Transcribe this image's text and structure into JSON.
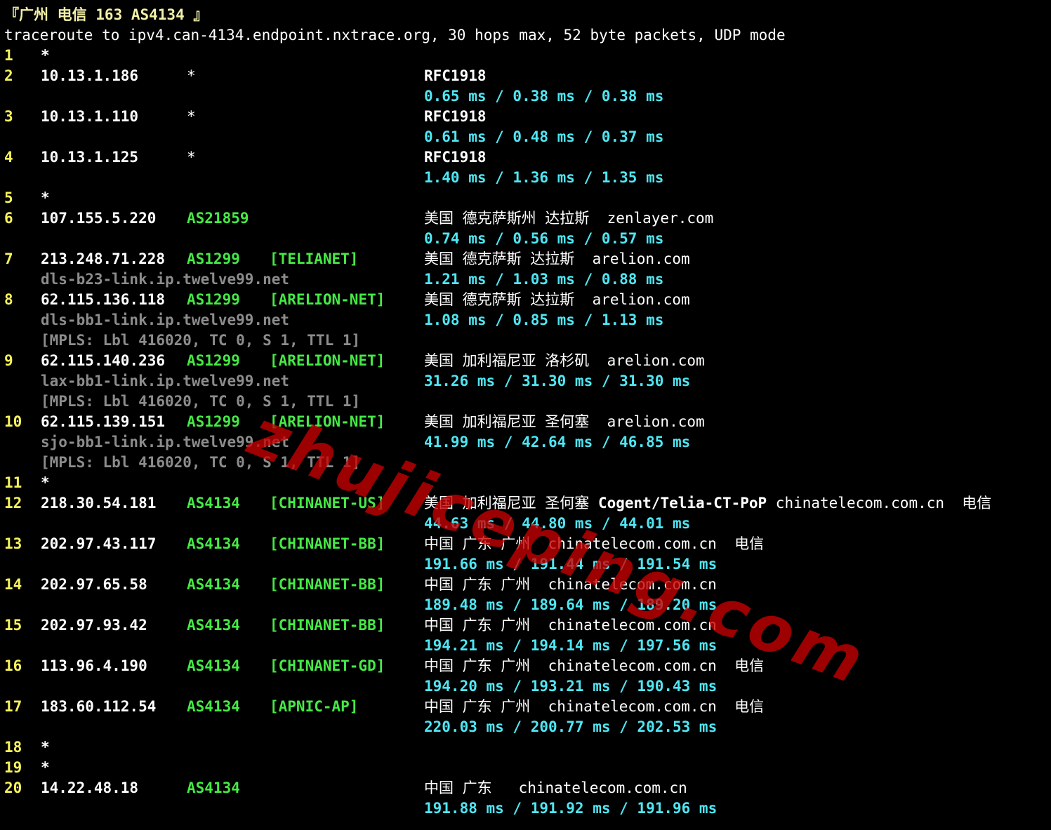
{
  "title": "『广州 电信 163 AS4134 』",
  "command": "traceroute to ipv4.can-4134.endpoint.nxtrace.org, 30 hops max, 52 byte packets, UDP mode",
  "hops": [
    {
      "n": "1",
      "ip": "*",
      "star2": "",
      "asn": "",
      "tag": "",
      "geo": "",
      "geob": "",
      "org": "",
      "rtt": "",
      "host": "",
      "mpls": ""
    },
    {
      "n": "2",
      "ip": "10.13.1.186",
      "star2": "*",
      "asn": "",
      "tag": "",
      "geo": "",
      "geob": "RFC1918",
      "org": "",
      "rtt": "0.65 ms / 0.38 ms / 0.38 ms",
      "host": "",
      "mpls": ""
    },
    {
      "n": "3",
      "ip": "10.13.1.110",
      "star2": "*",
      "asn": "",
      "tag": "",
      "geo": "",
      "geob": "RFC1918",
      "org": "",
      "rtt": "0.61 ms / 0.48 ms / 0.37 ms",
      "host": "",
      "mpls": ""
    },
    {
      "n": "4",
      "ip": "10.13.1.125",
      "star2": "*",
      "asn": "",
      "tag": "",
      "geo": "",
      "geob": "RFC1918",
      "org": "",
      "rtt": "1.40 ms / 1.36 ms / 1.35 ms",
      "host": "",
      "mpls": ""
    },
    {
      "n": "5",
      "ip": "*",
      "star2": "",
      "asn": "",
      "tag": "",
      "geo": "",
      "geob": "",
      "org": "",
      "rtt": "",
      "host": "",
      "mpls": ""
    },
    {
      "n": "6",
      "ip": "107.155.5.220",
      "star2": "",
      "asn": "AS21859",
      "tag": "",
      "geo": "美国 德克萨斯州 达拉斯  zenlayer.com",
      "geob": "",
      "org": "",
      "rtt": "0.74 ms / 0.56 ms / 0.57 ms",
      "host": "",
      "mpls": ""
    },
    {
      "n": "7",
      "ip": "213.248.71.228",
      "star2": "",
      "asn": "AS1299",
      "tag": "[TELIANET]",
      "geo": "美国 德克萨斯 达拉斯  arelion.com",
      "geob": "",
      "org": "",
      "rtt": "1.21 ms / 1.03 ms / 0.88 ms",
      "host": "dls-b23-link.ip.twelve99.net",
      "mpls": ""
    },
    {
      "n": "8",
      "ip": "62.115.136.118",
      "star2": "",
      "asn": "AS1299",
      "tag": "[ARELION-NET]",
      "geo": "美国 德克萨斯 达拉斯  arelion.com",
      "geob": "",
      "org": "",
      "rtt": "1.08 ms / 0.85 ms / 1.13 ms",
      "host": "dls-bb1-link.ip.twelve99.net",
      "mpls": "[MPLS: Lbl 416020, TC 0, S 1, TTL 1]"
    },
    {
      "n": "9",
      "ip": "62.115.140.236",
      "star2": "",
      "asn": "AS1299",
      "tag": "[ARELION-NET]",
      "geo": "美国 加利福尼亚 洛杉矶  arelion.com",
      "geob": "",
      "org": "",
      "rtt": "31.26 ms / 31.30 ms / 31.30 ms",
      "host": "lax-bb1-link.ip.twelve99.net",
      "mpls": "[MPLS: Lbl 416020, TC 0, S 1, TTL 1]"
    },
    {
      "n": "10",
      "ip": "62.115.139.151",
      "star2": "",
      "asn": "AS1299",
      "tag": "[ARELION-NET]",
      "geo": "美国 加利福尼亚 圣何塞  arelion.com",
      "geob": "",
      "org": "",
      "rtt": "41.99 ms / 42.64 ms / 46.85 ms",
      "host": "sjo-bb1-link.ip.twelve99.net",
      "mpls": "[MPLS: Lbl 416020, TC 0, S 1, TTL 1]"
    },
    {
      "n": "11",
      "ip": "*",
      "star2": "",
      "asn": "",
      "tag": "",
      "geo": "",
      "geob": "",
      "org": "",
      "rtt": "",
      "host": "",
      "mpls": ""
    },
    {
      "n": "12",
      "ip": "218.30.54.181",
      "star2": "",
      "asn": "AS4134",
      "tag": "[CHINANET-US]",
      "geo": "美国 加利福尼亚 圣何塞 ",
      "geob": "",
      "org": "Cogent/Telia-CT-PoP",
      "tail": " chinatelecom.com.cn  电信",
      "rtt": "44.63 ms / 44.80 ms / 44.01 ms",
      "host": "",
      "mpls": ""
    },
    {
      "n": "13",
      "ip": "202.97.43.117",
      "star2": "",
      "asn": "AS4134",
      "tag": "[CHINANET-BB]",
      "geo": "中国 广东 广州  chinatelecom.com.cn  电信",
      "geob": "",
      "org": "",
      "rtt": "191.66 ms / 191.44 ms / 191.54 ms",
      "host": "",
      "mpls": ""
    },
    {
      "n": "14",
      "ip": "202.97.65.58",
      "star2": "",
      "asn": "AS4134",
      "tag": "[CHINANET-BB]",
      "geo": "中国 广东 广州  chinatelecom.com.cn",
      "geob": "",
      "org": "",
      "rtt": "189.48 ms / 189.64 ms / 189.20 ms",
      "host": "",
      "mpls": ""
    },
    {
      "n": "15",
      "ip": "202.97.93.42",
      "star2": "",
      "asn": "AS4134",
      "tag": "[CHINANET-BB]",
      "geo": "中国 广东 广州  chinatelecom.com.cn",
      "geob": "",
      "org": "",
      "rtt": "194.21 ms / 194.14 ms / 197.56 ms",
      "host": "",
      "mpls": ""
    },
    {
      "n": "16",
      "ip": "113.96.4.190",
      "star2": "",
      "asn": "AS4134",
      "tag": "[CHINANET-GD]",
      "geo": "中国 广东 广州  chinatelecom.com.cn  电信",
      "geob": "",
      "org": "",
      "rtt": "194.20 ms / 193.21 ms / 190.43 ms",
      "host": "",
      "mpls": ""
    },
    {
      "n": "17",
      "ip": "183.60.112.54",
      "star2": "",
      "asn": "AS4134",
      "tag": "[APNIC-AP]",
      "geo": "中国 广东 广州  chinatelecom.com.cn  电信",
      "geob": "",
      "org": "",
      "rtt": "220.03 ms / 200.77 ms / 202.53 ms",
      "host": "",
      "mpls": ""
    },
    {
      "n": "18",
      "ip": "*",
      "star2": "",
      "asn": "",
      "tag": "",
      "geo": "",
      "geob": "",
      "org": "",
      "rtt": "",
      "host": "",
      "mpls": ""
    },
    {
      "n": "19",
      "ip": "*",
      "star2": "",
      "asn": "",
      "tag": "",
      "geo": "",
      "geob": "",
      "org": "",
      "rtt": "",
      "host": "",
      "mpls": ""
    },
    {
      "n": "20",
      "ip": "14.22.48.18",
      "star2": "",
      "asn": "AS4134",
      "tag": "",
      "geo": "中国 广东   chinatelecom.com.cn",
      "geob": "",
      "org": "",
      "rtt": "191.88 ms / 191.92 ms / 191.96 ms",
      "host": "",
      "mpls": ""
    }
  ],
  "watermark": "zhujiceping.com",
  "colors": {
    "background": "#000000",
    "hop": "#f7f35b",
    "asn": "#45ea45",
    "rtt": "#4fe6f3",
    "host": "#8c8c8c",
    "watermark": "#c80000"
  }
}
